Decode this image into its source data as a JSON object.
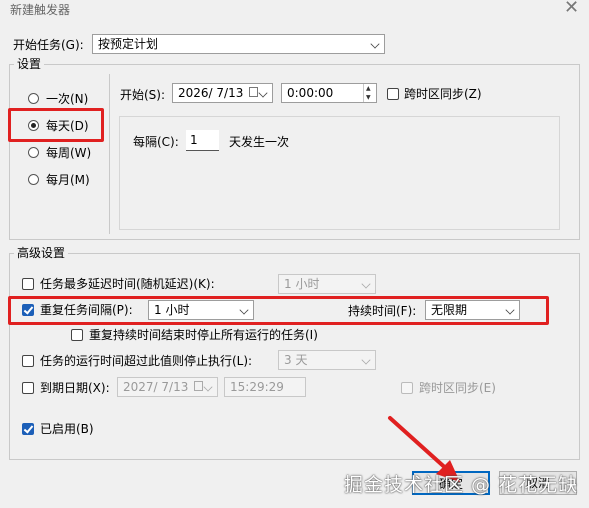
{
  "window": {
    "title": "新建触发器"
  },
  "start_task": {
    "label": "开始任务(G):",
    "value": "按预定计划"
  },
  "settings": {
    "group_title": "设置",
    "schedule_options": [
      {
        "label": "一次(N)",
        "selected": false
      },
      {
        "label": "每天(D)",
        "selected": true
      },
      {
        "label": "每周(W)",
        "selected": false
      },
      {
        "label": "每月(M)",
        "selected": false
      }
    ],
    "start": {
      "label": "开始(S):",
      "date": "2026/  7/13",
      "time": "0:00:00"
    },
    "sync_timezone": {
      "label": "跨时区同步(Z)",
      "checked": false
    },
    "recur": {
      "label": "每隔(C):",
      "value": "1",
      "suffix": "天发生一次"
    }
  },
  "advanced": {
    "group_title": "高级设置",
    "delay": {
      "label": "任务最多延迟时间(随机延迟)(K):",
      "value": "1 小时",
      "checked": false
    },
    "repeat": {
      "label": "重复任务间隔(P):",
      "value": "1 小时",
      "checked": true,
      "duration_label": "持续时间(F):",
      "duration_value": "无限期"
    },
    "stop_at_end": {
      "label": "重复持续时间结束时停止所有运行的任务(I)",
      "checked": false
    },
    "stop_if_longer": {
      "label": "任务的运行时间超过此值则停止执行(L):",
      "value": "3 天",
      "checked": false
    },
    "expire": {
      "label": "到期日期(X):",
      "date": "2027/  7/13",
      "time": "15:29:29",
      "checked": false,
      "sync_label": "跨时区同步(E)"
    },
    "enabled": {
      "label": "已启用(B)",
      "checked": true
    }
  },
  "buttons": {
    "ok": "确定",
    "cancel": "取消"
  },
  "watermark": "掘金技术社区 @ 花花无缺",
  "colors": {
    "highlight": "#e02020",
    "checkbox_accent": "#1c5fb8"
  }
}
